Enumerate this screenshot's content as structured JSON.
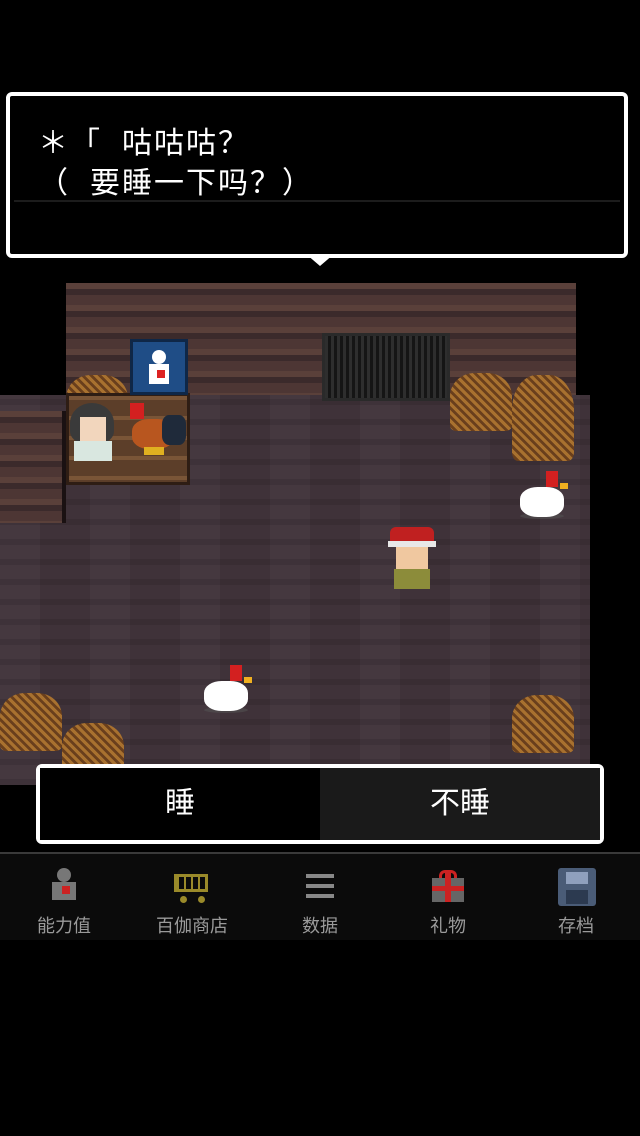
{
  "dialog": {
    "line1": "＊「 咕咕咕？",
    "line2": "（ 要睡一下吗？）"
  },
  "choices": {
    "option1": "睡",
    "option2": "不睡"
  },
  "menu": {
    "items": [
      {
        "label": "能力值",
        "icon": "status-icon"
      },
      {
        "label": "百伽商店",
        "icon": "shopping-cart-icon"
      },
      {
        "label": "数据",
        "icon": "list-icon"
      },
      {
        "label": "礼物",
        "icon": "gift-icon"
      },
      {
        "label": "存档",
        "icon": "save-floppy-icon"
      }
    ]
  },
  "colors": {
    "floor": "#3f3239",
    "wall": "#4a3433",
    "menu_label": "#9a9a9a",
    "dialog_border": "#ffffff"
  }
}
